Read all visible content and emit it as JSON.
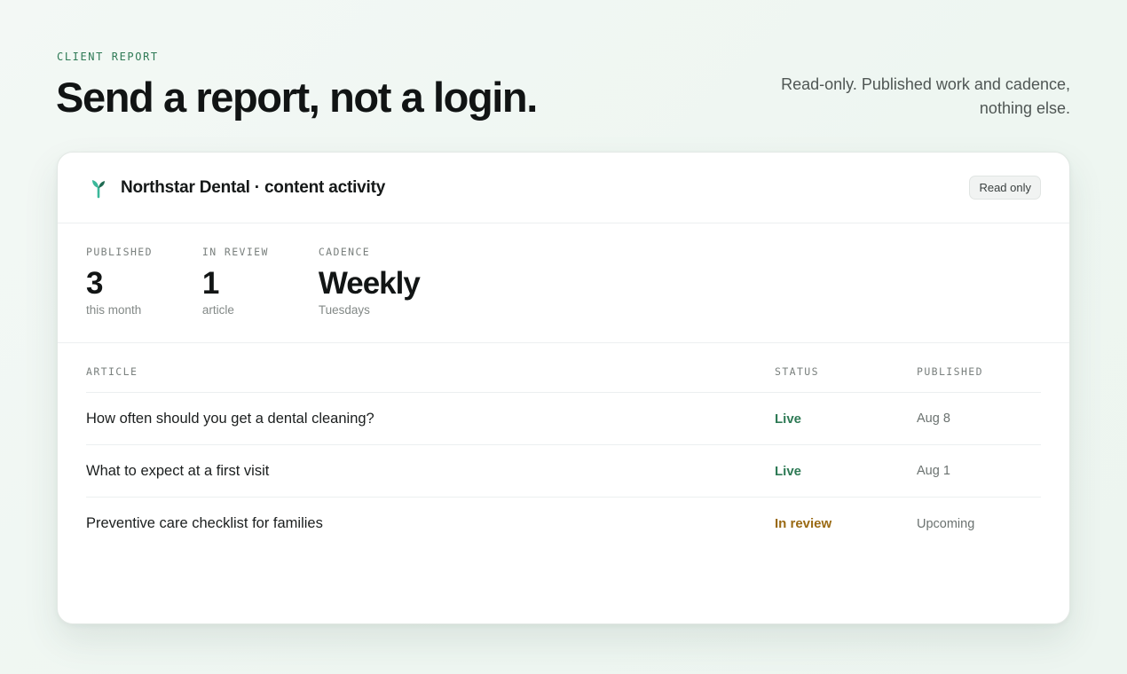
{
  "header": {
    "eyebrow": "CLIENT REPORT",
    "headline": "Send a report, not a login.",
    "tagline": "Read-only. Published work and cadence, nothing else."
  },
  "card": {
    "icon": "sprout-icon",
    "title": "Northstar Dental · content activity",
    "badge": "Read only",
    "stats": [
      {
        "label": "PUBLISHED",
        "value": "3",
        "sub": "this month"
      },
      {
        "label": "IN REVIEW",
        "value": "1",
        "sub": "article"
      },
      {
        "label": "CADENCE",
        "value": "Weekly",
        "sub": "Tuesdays"
      }
    ],
    "table": {
      "columns": [
        "ARTICLE",
        "STATUS",
        "PUBLISHED"
      ],
      "rows": [
        {
          "article": "How often should you get a dental cleaning?",
          "status": "Live",
          "status_color": "#2e7a55",
          "published": "Aug 8"
        },
        {
          "article": "What to expect at a first visit",
          "status": "Live",
          "status_color": "#2e7a55",
          "published": "Aug 1"
        },
        {
          "article": "Preventive care checklist for families",
          "status": "In review",
          "status_color": "#9a6a14",
          "published": "Upcoming"
        }
      ]
    }
  },
  "colors": {
    "accent": "#2e7a55",
    "icon_accent": "#3bb89a",
    "review": "#9a6a14"
  }
}
